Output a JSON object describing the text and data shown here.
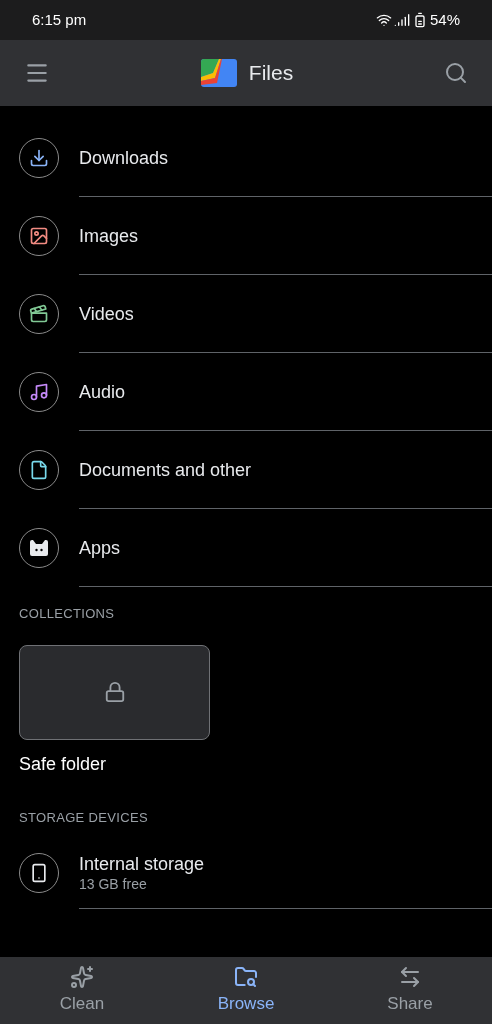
{
  "status_bar": {
    "time": "6:15 pm",
    "battery": "54%"
  },
  "app_bar": {
    "title": "Files"
  },
  "categories": [
    {
      "label": "Downloads",
      "kind": "download",
      "color": "#8ab4f8"
    },
    {
      "label": "Images",
      "kind": "image",
      "color": "#f28b82"
    },
    {
      "label": "Videos",
      "kind": "video",
      "color": "#81c995"
    },
    {
      "label": "Audio",
      "kind": "audio",
      "color": "#c58af9"
    },
    {
      "label": "Documents and other",
      "kind": "document",
      "color": "#78d9ec"
    },
    {
      "label": "Apps",
      "kind": "apps",
      "color": "#e8eaed"
    }
  ],
  "collections": {
    "heading": "COLLECTIONS",
    "items": [
      {
        "label": "Safe folder"
      }
    ]
  },
  "storage": {
    "heading": "STORAGE DEVICES",
    "items": [
      {
        "label": "Internal storage",
        "detail": "13 GB free"
      }
    ]
  },
  "bottom_nav": [
    {
      "label": "Clean",
      "kind": "clean",
      "selected": false
    },
    {
      "label": "Browse",
      "kind": "browse",
      "selected": true
    },
    {
      "label": "Share",
      "kind": "share",
      "selected": false
    }
  ]
}
